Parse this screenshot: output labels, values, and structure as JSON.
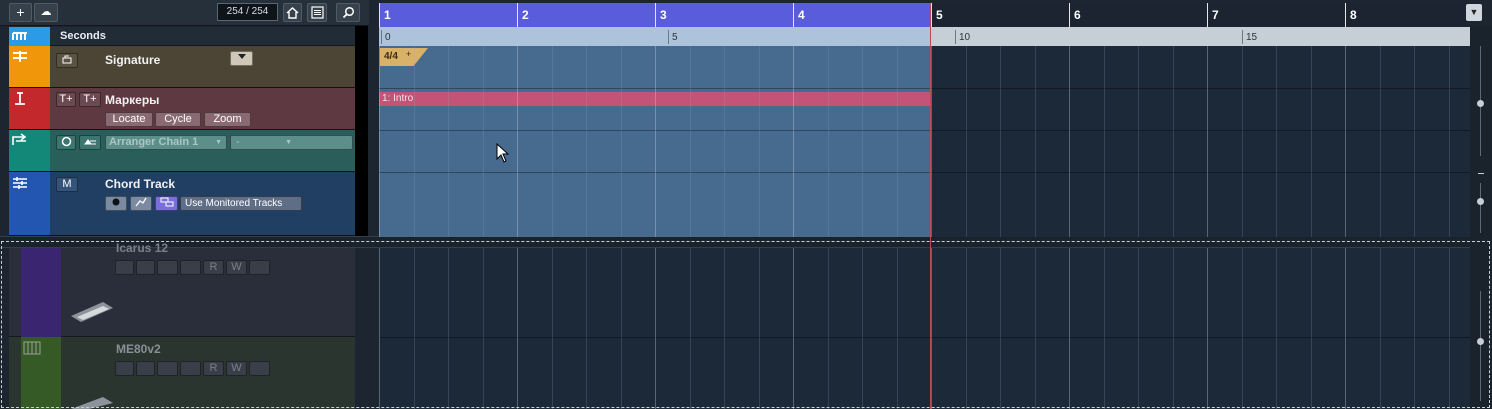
{
  "toolbar": {
    "add_label": "+",
    "add_folder_label": "☁",
    "counter": "254 / 254",
    "home_icon": "home-icon",
    "list_icon": "list-icon",
    "search_icon": "search-icon"
  },
  "ruler": {
    "time_format": "Seconds",
    "bars": [
      "1",
      "2",
      "3",
      "4",
      "5",
      "6",
      "7",
      "8"
    ],
    "seconds": [
      "0",
      "5",
      "10",
      "15"
    ],
    "dropdown": "▼"
  },
  "tracks": {
    "signature": {
      "name": "Signature",
      "event": "4/4",
      "event_plus": "+"
    },
    "markers": {
      "name": "Маркеры",
      "btn_locate": "Locate",
      "btn_cycle": "Cycle",
      "btn_zoom": "Zoom",
      "t1": "T+",
      "t2": "T+",
      "marker_event": "1: Intro"
    },
    "arranger": {
      "chain": "Arranger Chain 1",
      "second": "-"
    },
    "chord": {
      "name": "Chord Track",
      "btn_m": "M",
      "use_monitored": "Use Monitored Tracks"
    },
    "inst1": {
      "name": "Icarus 12",
      "r": "R",
      "w": "W"
    },
    "inst2": {
      "name": "ME80v2",
      "r": "R",
      "w": "W"
    }
  },
  "colors": {
    "signature": "#f0960a",
    "markers": "#c3282c",
    "arranger": "#138878",
    "chord": "#2356b0",
    "inst1": "#4a2d8e",
    "inst2": "#3f6a2c",
    "cycle": "#5a5ddb"
  }
}
